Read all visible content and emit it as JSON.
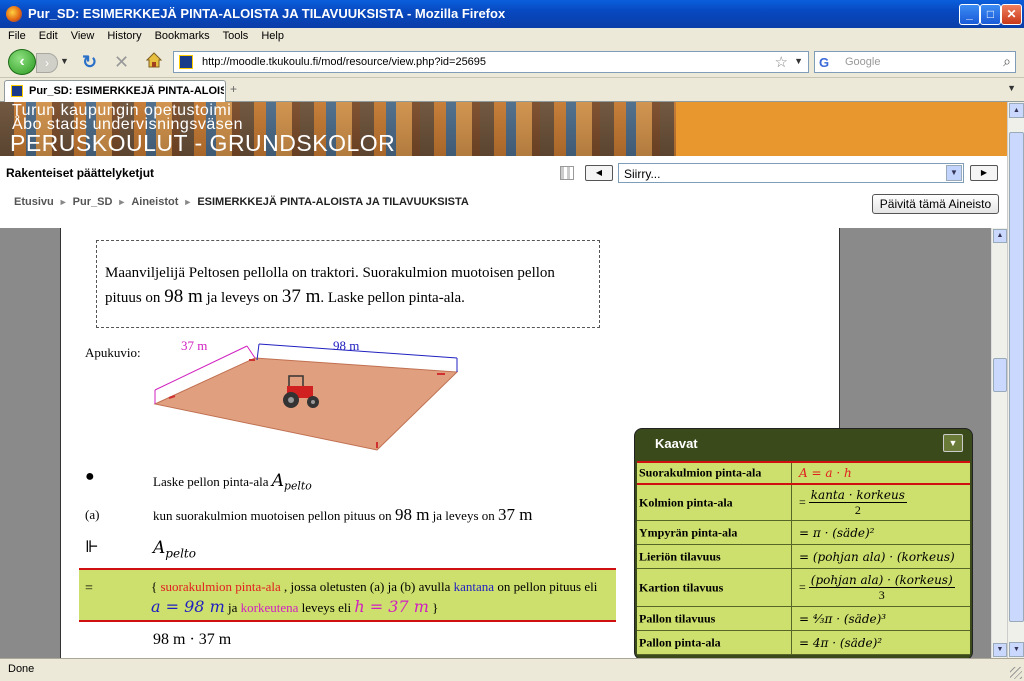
{
  "window": {
    "title": "Pur_SD: ESIMERKKEJÄ PINTA-ALOISTA JA TILAVUUKSISTA - Mozilla Firefox",
    "minimize": "_",
    "maximize": "□",
    "close": "✕"
  },
  "menu": [
    "File",
    "Edit",
    "View",
    "History",
    "Bookmarks",
    "Tools",
    "Help"
  ],
  "nav": {
    "url": "http://moodle.tkukoulu.fi/mod/resource/view.php?id=25695",
    "search_placeholder": "Google"
  },
  "tab": {
    "label": "Pur_SD: ESIMERKKEJÄ PINTA-ALOIST...",
    "new_tab": "+"
  },
  "banner": {
    "line1": "Turun kaupungin opetustoimi",
    "line2": "Åbo stads undervisningsväsen",
    "line3": "PERUSKOULUT - GRUNDSKOLOR"
  },
  "moodle": {
    "course": "Rakenteiset päättelyketjut",
    "jump_value": "Siirry...",
    "breadcrumbs": [
      "Etusivu",
      "Pur_SD",
      "Aineistot",
      "ESIMERKKEJÄ PINTA-ALOISTA JA TILAVUUKSISTA"
    ],
    "update_button": "Päivitä tämä Aineisto"
  },
  "content": {
    "problem_line1": "Maanviljelijä Peltosen pellolla on traktori. Suorakulmion muotoisen pellon",
    "problem_pre": "pituus on ",
    "problem_len": "98 m",
    "problem_mid": " ja leveys on ",
    "problem_wid": "37 m",
    "problem_end": ". Laske pellon pinta-ala.",
    "apukuvio": "Apukuvio:",
    "dim_width": "37 m",
    "dim_length": "98 m",
    "bullet": "●",
    "q1_text": "Laske pellon pinta-ala ",
    "q1_var": "A",
    "q1_sub": "pelto",
    "a_label": "(a)",
    "a_text1": "kun suorakulmion muotoisen pellon pituus on ",
    "a_len": "98 m",
    "a_text2": " ja leveys on ",
    "a_wid": "37 m",
    "turnstile": "⊩",
    "apelto_var": "A",
    "apelto_sub": "pelto",
    "eq_sign": "=",
    "hl_open": "{ ",
    "hl_red": "suorakulmion pinta-ala",
    "hl_mid": " , jossa oletusten (a) ja (b) avulla ",
    "hl_blue": "kantana",
    "hl_end": " on pellon pituus eli",
    "hl_a": "a = 98 m",
    "hl_ja": " ja ",
    "hl_mag": "korkeutena",
    "hl_lev": " leveys eli ",
    "hl_h": "h = 37 m",
    "hl_close": " }",
    "calc": "98 m  · 37 m"
  },
  "formulas": {
    "title": "Kaavat",
    "collapse": "▼",
    "rows": [
      {
        "name": "Suorakulmion pinta-ala",
        "formula": "A = a · h"
      },
      {
        "name": "Kolmion pinta-ala",
        "eq": "=",
        "num": "kanta · korkeus",
        "den": "2"
      },
      {
        "name": "Ympyrän pinta-ala",
        "formula": "= π · (säde)²"
      },
      {
        "name": "Lieriön tilavuus",
        "formula": "= (pohjan ala) · (korkeus)"
      },
      {
        "name": "Kartion tilavuus",
        "eq": "=",
        "num": "(pohjan ala) · (korkeus)",
        "den": "3"
      },
      {
        "name": "Pallon tilavuus",
        "formula": "= ⁴⁄₃π · (säde)³"
      },
      {
        "name": "Pallon pinta-ala",
        "formula": "= 4π · (säde)²"
      }
    ]
  },
  "status": "Done",
  "colors": {
    "highlight": "#cddf6c",
    "panel_header": "#3a4a1a",
    "red": "#e02020",
    "blue": "#2020c0",
    "magenta": "#d020c0"
  }
}
